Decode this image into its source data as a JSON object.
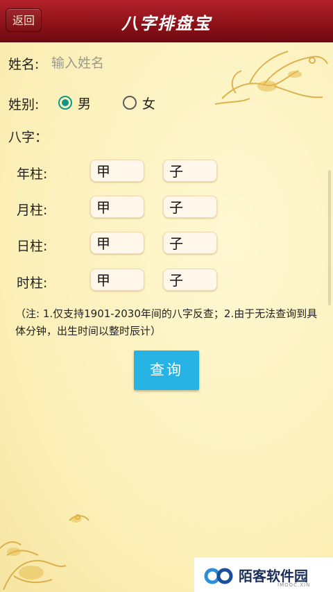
{
  "header": {
    "back_label": "返回",
    "title": "八字排盘宝"
  },
  "form": {
    "name_label": "姓名:",
    "name_placeholder": "输入姓名",
    "name_value": "",
    "gender_label": "姓别:",
    "gender_options": [
      {
        "label": "男",
        "selected": true
      },
      {
        "label": "女",
        "selected": false
      }
    ],
    "bazi_label": "八字：",
    "pillars": [
      {
        "label": "年柱:",
        "stem": "甲",
        "branch": "子"
      },
      {
        "label": "月柱:",
        "stem": "甲",
        "branch": "子"
      },
      {
        "label": "日柱:",
        "stem": "甲",
        "branch": "子"
      },
      {
        "label": "时柱:",
        "stem": "甲",
        "branch": "子"
      }
    ],
    "note": "（注: 1.仅支持1901-2030年间的八字反查；2.由于无法查询到具体分钟，出生时间以整时辰计）",
    "query_label": "查询"
  },
  "watermark": {
    "text": "陌客软件园",
    "sub": "IMOOC.XIN"
  },
  "colors": {
    "title_bar": "#8c1118",
    "background": "#fdf5c4",
    "radio_accent": "#0f9688",
    "button": "#27b4e4"
  }
}
